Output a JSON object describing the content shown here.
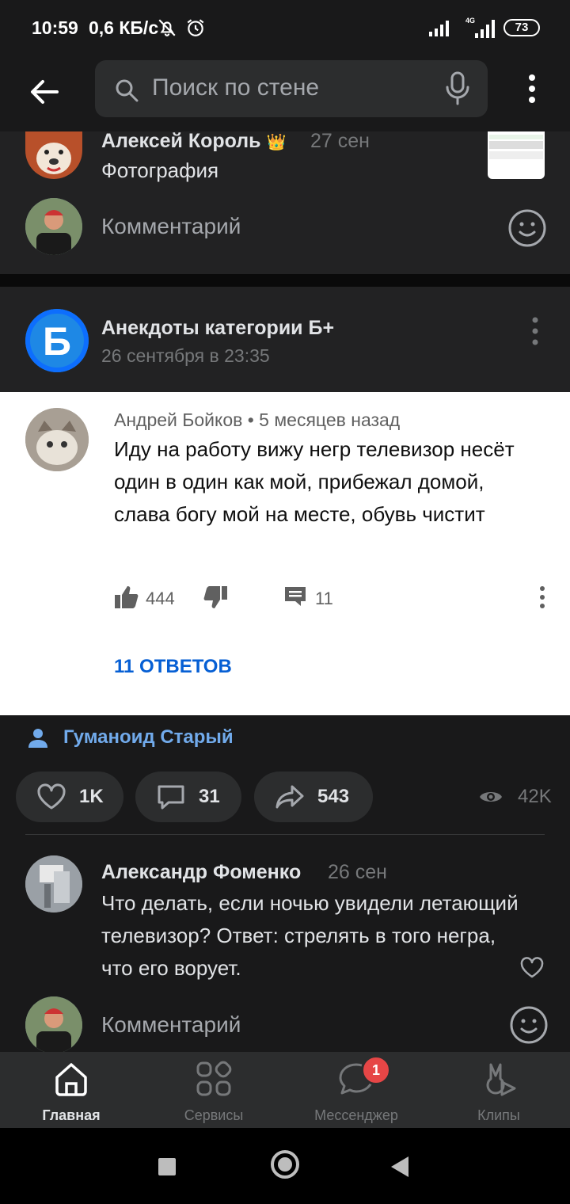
{
  "status_bar": {
    "time": "10:59",
    "speed": "0,6 КБ/с",
    "network": "4G",
    "battery": "73"
  },
  "toolbar": {
    "search_placeholder": "Поиск по стене"
  },
  "comment1": {
    "author": "Алексей Король",
    "badge": "👑",
    "date": "27 сен",
    "text": "Фотография"
  },
  "comment_input": {
    "placeholder": "Комментарий"
  },
  "post": {
    "group_name": "Анекдоты категории Б+",
    "date": "26 сентября в 23:35",
    "embedded_comment": {
      "meta": "Андрей Бойков • 5 месяцев назад",
      "text": "Иду на работу вижу негр телевизор несёт один в один как мой, прибежал домой, слава богу мой на месте, обувь чистит",
      "likes": "444",
      "replies_count": "11",
      "replies_label": "11 ОТВЕТОВ"
    },
    "author_signature": "Гуманоид Старый",
    "likes": "1K",
    "comments": "31",
    "shares": "543",
    "views": "42K"
  },
  "comment2": {
    "author": "Александр Фоменко",
    "date": "26 сен",
    "text": "Что делать, если ночью увидели летающий телевизор?  Ответ: стрелять в того негра, что его ворует."
  },
  "tabbar": {
    "tabs": [
      {
        "label": "Главная",
        "icon": "home-icon",
        "active": true
      },
      {
        "label": "Сервисы",
        "icon": "services-icon"
      },
      {
        "label": "Мессенджер",
        "icon": "messenger-icon",
        "badge": "1"
      },
      {
        "label": "Клипы",
        "icon": "clips-icon"
      }
    ]
  },
  "colors": {
    "background": "#19191a",
    "card": "#222223",
    "link": "#71aaeb",
    "badge": "#e64646"
  }
}
